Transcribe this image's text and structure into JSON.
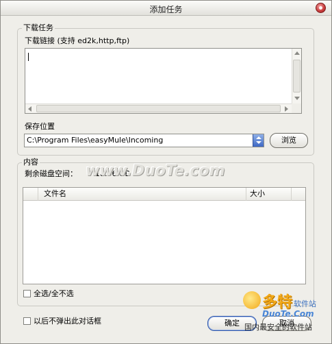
{
  "window": {
    "title": "添加任务"
  },
  "download_group": {
    "title": "下载任务",
    "links_label": "下载链接 (支持 ed2k,http,ftp)",
    "links_value": "",
    "save_location_label": "保存位置",
    "save_path": "C:\\Program Files\\easyMule\\Incoming",
    "browse_label": "浏览"
  },
  "content_group": {
    "title": "内容",
    "free_space_label": "剩余磁盘空间：",
    "free_space_value": "18.06 GB",
    "columns": [
      "文件名",
      "大小"
    ],
    "files": [],
    "select_all_label": "全选/全不选"
  },
  "footer": {
    "dont_show_label": "以后不弹出此对话框",
    "ok_label": "确定",
    "cancel_label": "取消"
  },
  "watermark": {
    "main_text": "www.DuoTe.com",
    "logo_big": "多特",
    "logo_small": "软件站",
    "logo_url": "DuoTe.Com",
    "logo_line": "国内最安全的软件站"
  }
}
